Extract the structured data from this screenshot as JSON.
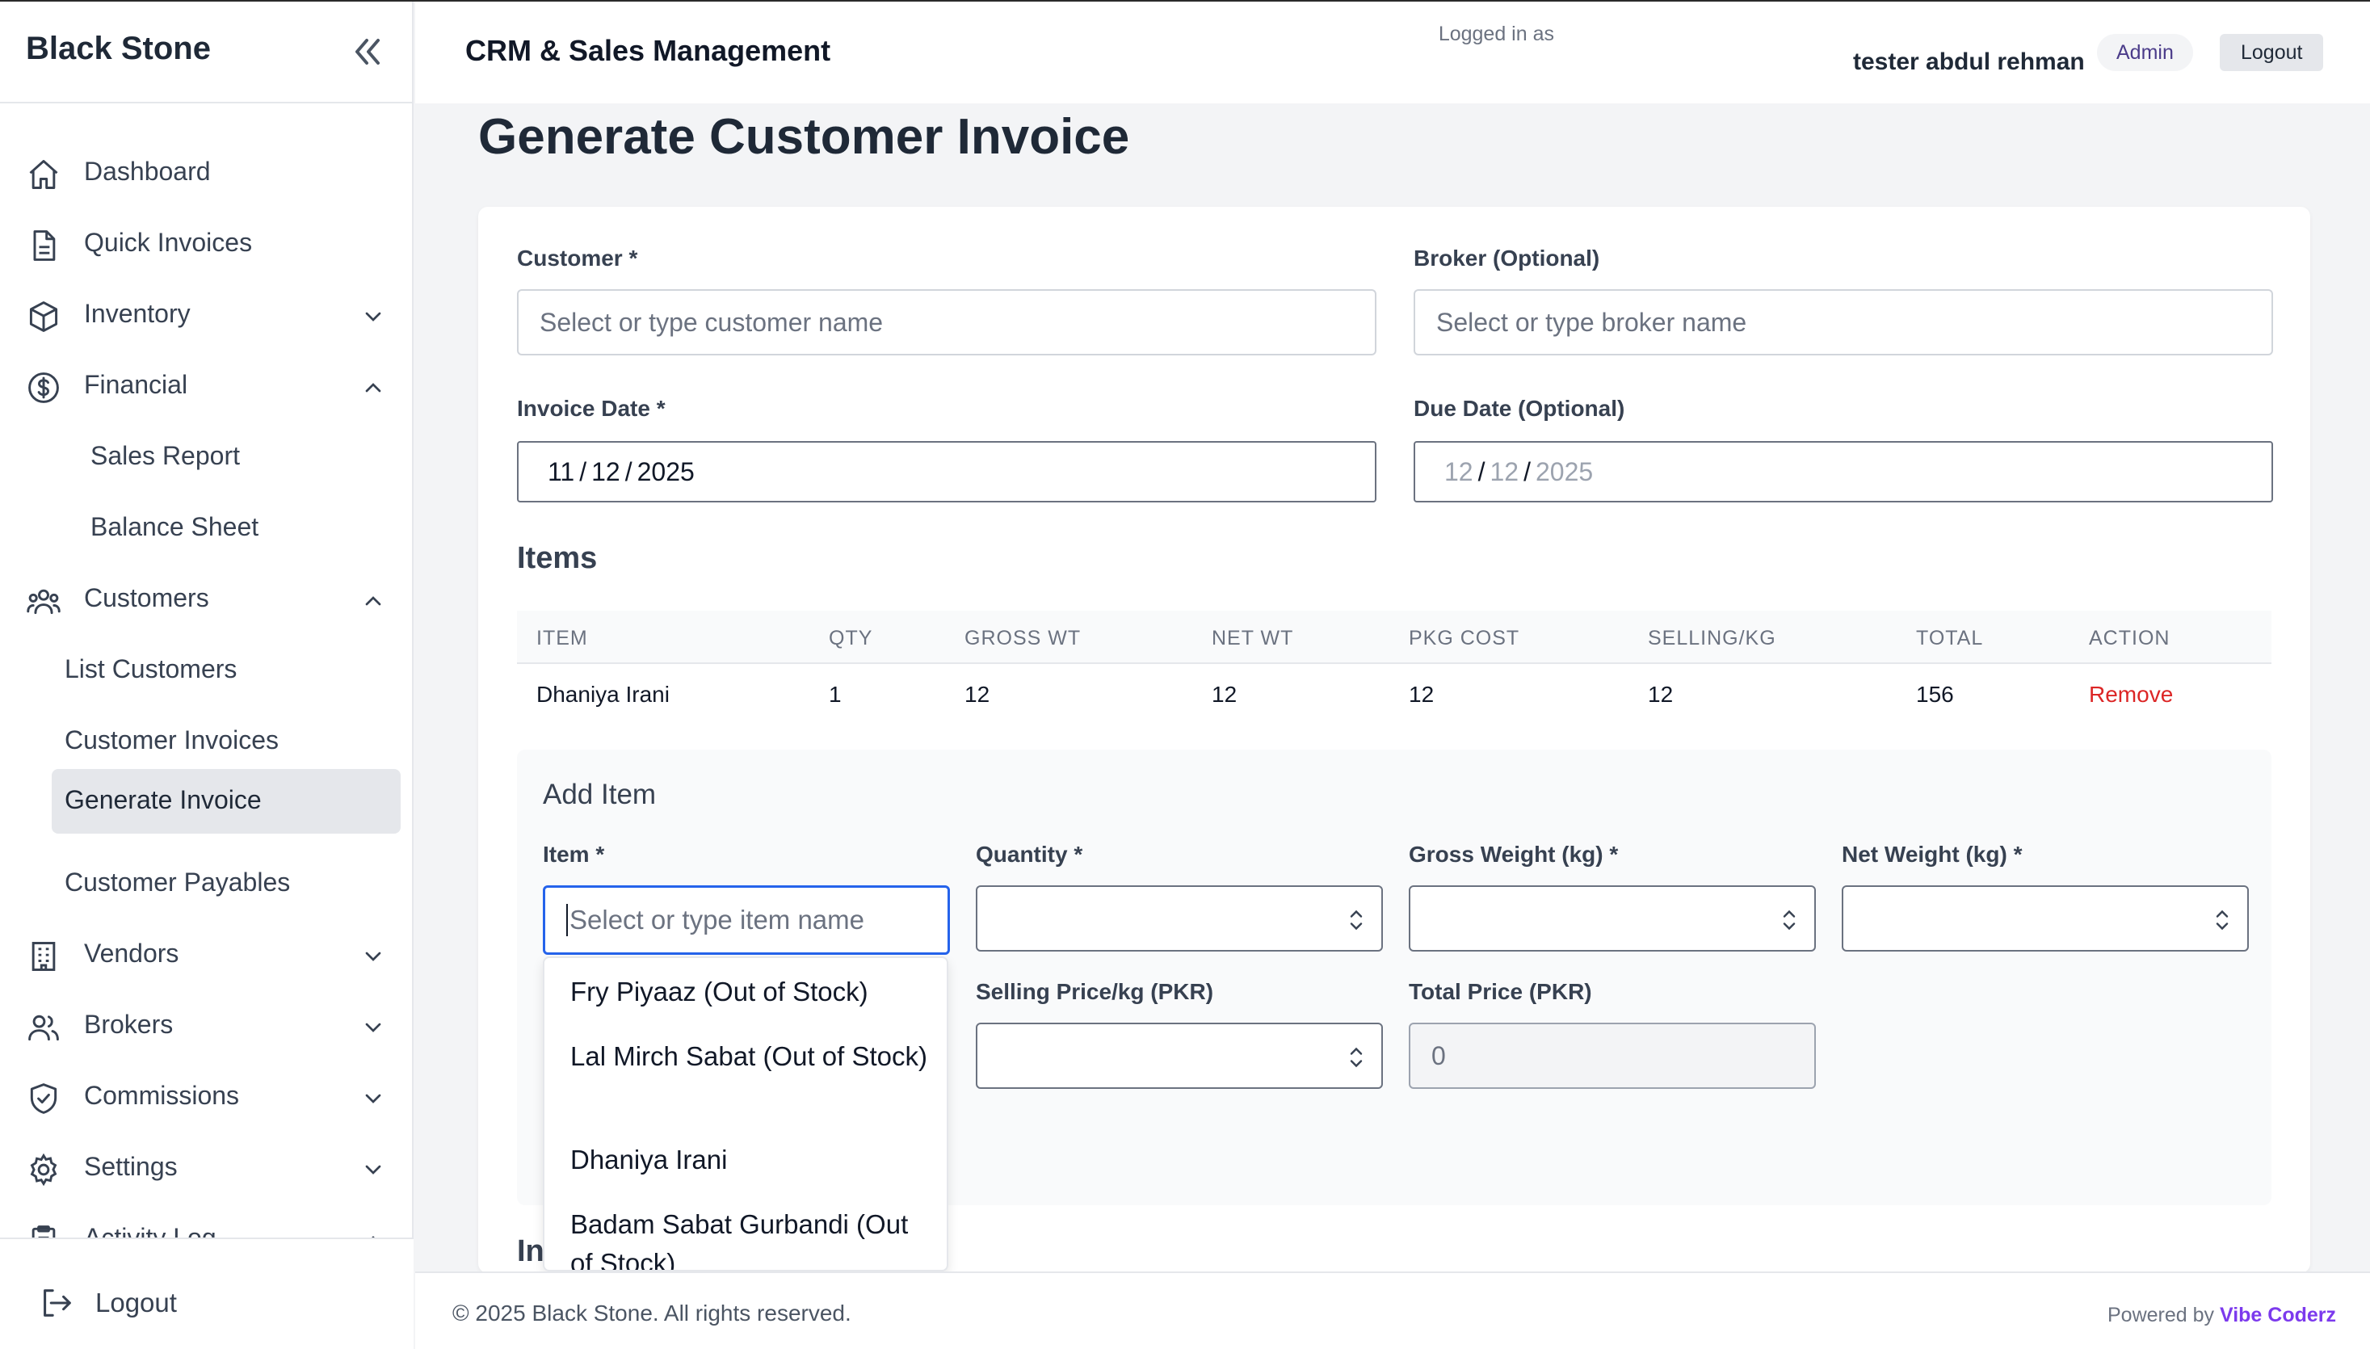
{
  "brand": "Black Stone",
  "header": {
    "title": "CRM & Sales Management",
    "logged_in_label": "Logged in as",
    "user_name": "tester abdul rehman",
    "role_badge": "Admin",
    "logout_label": "Logout"
  },
  "sidebar": {
    "items": [
      {
        "label": "Dashboard",
        "icon": "home-icon"
      },
      {
        "label": "Quick Invoices",
        "icon": "document-icon"
      },
      {
        "label": "Inventory",
        "icon": "cube-icon"
      },
      {
        "label": "Financial",
        "icon": "dollar-icon"
      },
      {
        "label": "Customers",
        "icon": "users-icon"
      },
      {
        "label": "Vendors",
        "icon": "building-icon"
      },
      {
        "label": "Brokers",
        "icon": "user-group-icon"
      },
      {
        "label": "Commissions",
        "icon": "shield-check-icon"
      },
      {
        "label": "Settings",
        "icon": "gear-icon"
      },
      {
        "label": "Activity Log",
        "icon": "clipboard-icon"
      }
    ],
    "financial_sub": [
      "Sales Report",
      "Balance Sheet"
    ],
    "customers_sub": [
      "List Customers",
      "Customer Invoices",
      "Generate Invoice",
      "Customer Payables"
    ],
    "active_sub": "Generate Invoice",
    "logout_label": "Logout"
  },
  "page": {
    "title": "Generate Customer Invoice",
    "customer_label": "Customer *",
    "customer_placeholder": "Select or type customer name",
    "broker_label": "Broker (Optional)",
    "broker_placeholder": "Select or type broker name",
    "invoice_date_label": "Invoice Date *",
    "invoice_date": {
      "mm": "11",
      "dd": "12",
      "yyyy": "2025"
    },
    "due_date_label": "Due Date (Optional)",
    "due_date": {
      "mm": "12",
      "dd": "12",
      "yyyy": "2025"
    },
    "items_title": "Items",
    "table": {
      "headers": [
        "ITEM",
        "QTY",
        "GROSS WT",
        "NET WT",
        "PKG COST",
        "SELLING/KG",
        "TOTAL",
        "ACTION"
      ],
      "rows": [
        {
          "item": "Dhaniya Irani",
          "qty": "1",
          "gross_wt": "12",
          "net_wt": "12",
          "pkg_cost": "12",
          "selling_kg": "12",
          "total": "156",
          "action": "Remove"
        }
      ]
    },
    "add_item": {
      "title": "Add Item",
      "item_label": "Item *",
      "item_placeholder": "Select or type item name",
      "quantity_label": "Quantity *",
      "gross_label": "Gross Weight (kg) *",
      "net_label": "Net Weight (kg) *",
      "selling_label": "Selling Price/kg (PKR)",
      "total_label": "Total Price (PKR)",
      "total_value": "0"
    },
    "dropdown_options": [
      "Fry Piyaaz (Out of Stock)",
      "Lal Mirch Sabat (Out of Stock)",
      "Dhaniya Irani",
      "Badam Sabat Gurbandi (Out of Stock)"
    ],
    "partial_heading": "In"
  },
  "footer": {
    "copyright": "© 2025 Black Stone. All rights reserved.",
    "powered_by": "Powered by",
    "powered_brand": "Vibe Coderz"
  },
  "colors": {
    "accent_focus": "#2563eb",
    "danger": "#dc2626",
    "powered_brand": "#7c3aed"
  }
}
